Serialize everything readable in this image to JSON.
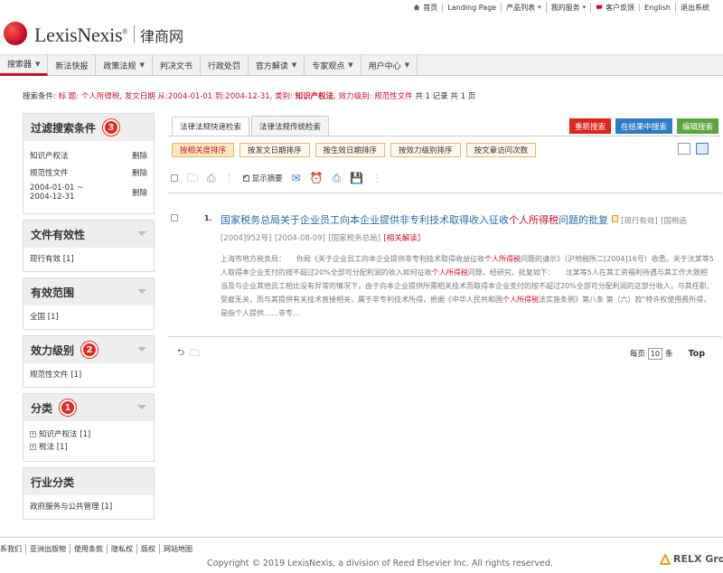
{
  "toplinks": [
    {
      "label": "首页",
      "icon": "home-icon"
    },
    {
      "label": "Landing Page",
      "icon": ""
    },
    {
      "label": "产品列表",
      "icon": "caret"
    },
    {
      "label": "我的服务",
      "icon": "caret"
    },
    {
      "label": "客户反馈",
      "icon": "chat-icon"
    },
    {
      "label": "English",
      "icon": ""
    },
    {
      "label": "退出系统",
      "icon": ""
    }
  ],
  "brand": {
    "name": "LexisNexis",
    "mark": "®",
    "cn": "律商网"
  },
  "nav": [
    {
      "label": "搜索器",
      "caret": true
    },
    {
      "label": "新法快报",
      "caret": false
    },
    {
      "label": "政策法规",
      "caret": true
    },
    {
      "label": "判决文书",
      "caret": false
    },
    {
      "label": "行政处罚",
      "caret": false
    },
    {
      "label": "官方解读",
      "caret": true
    },
    {
      "label": "专家观点",
      "caret": true
    },
    {
      "label": "用户中心",
      "caret": true
    }
  ],
  "search_conditions": {
    "prefix": "搜索条件: ",
    "part1": "标 题: 个人所得税, 发文日期 从:2004-01-01 到:2004-12-31, 类别: ",
    "bold1": "知识产权法",
    "part2": ", 效力级别: 规范性文件",
    "summary": "  共 1 记录  共 1 页"
  },
  "sidebar": {
    "filter_title": "过滤搜索条件",
    "filter_badge": "3",
    "filters": [
      {
        "label": "知识产权法",
        "action": "删除"
      },
      {
        "label": "规范性文件",
        "action": "删除"
      },
      {
        "label": "2004-01-01 ~\n2004-12-31",
        "action": "删除"
      }
    ],
    "validity": {
      "title": "文件有效性",
      "items": [
        "现行有效 [1]"
      ]
    },
    "scope": {
      "title": "有效范围",
      "items": [
        "全国 [1]"
      ]
    },
    "level": {
      "title": "效力级别",
      "badge": "2",
      "items": [
        "规范性文件 [1]"
      ]
    },
    "category": {
      "title": "分类",
      "badge": "1",
      "items": [
        "知识产权法 [1]",
        "税法 [1]"
      ]
    },
    "industry": {
      "title": "行业分类",
      "items": [
        "政府服务与公共管理 [1]"
      ]
    }
  },
  "tabs": [
    "法律法规快速检索",
    "法律法规传统检索"
  ],
  "actions": {
    "new_search": "重新搜索",
    "search_in_results": "在结果中搜索",
    "edit_search": "编辑搜索"
  },
  "sort_buttons": [
    "按相关度排序",
    "按发文日期排序",
    "按生效日期排序",
    "按效力级别排序",
    "按文章访问次数"
  ],
  "toolbar": {
    "show_summary": "显示摘要"
  },
  "result": {
    "number": "1.",
    "title_a": "国家税务总局关于企业员工向本企业提供非专利技术取得收入征收",
    "title_hl": "个人所得税",
    "title_b": "问题的批复",
    "status": "[现行有效]",
    "doc_no": "[国税函[2004]952号]",
    "date": "[2004-08-09]",
    "issuer": "[国家税务总局]",
    "related": "[相关解读]",
    "snippet_a": "上海市地方税务局：　　你局《关于企业员工向本企业提供非专利技术取得收益征收",
    "snippet_hl1": "个人所得税",
    "snippet_b": "问题的请示》（沪地税所二[2004]16号）收悉。关于沈某等5人取得本企业支付的按不超过20%全部可分配利润的收入如何征收",
    "snippet_hl2": "个人所得税",
    "snippet_c": "问题，经研究，批复如下：　　沈某等5人在其工资福利待遇与其工作大致相当及与企业其他员工相比没有异常的情况下，由于向本企业提供所需相关技术而取得本企业支付的按不超过20%全部可分配利润的这部分收入，与其任职、受雇无关，而与其提供有关技术直接相关，属于非专利技术所得，根据《中华人民共和国",
    "snippet_hl3": "个人所得税",
    "snippet_d": "法实施条例》第八条 第（六）款\"特许权使用费所得，是指个人提供……非专…"
  },
  "paging": {
    "per_page_label": "每页",
    "per_page_value": "10",
    "unit": "条",
    "top": "Top"
  },
  "footer": {
    "links": [
      "系我们",
      "亚洲出版物",
      "使用条款",
      "隐私权",
      "版权",
      "网站地图"
    ],
    "copyright": "Copyright © 2019 LexisNexis, a division of Reed Elsevier Inc. All rights reserved.",
    "relx": "RELX Grou"
  },
  "colors": {
    "brand_red": "#c8102e",
    "link_blue": "#2a6ab0",
    "btn_red": "#e0261b",
    "btn_blue": "#2e7cc8",
    "btn_green": "#5ca53a",
    "badge_red": "#e8261e"
  }
}
